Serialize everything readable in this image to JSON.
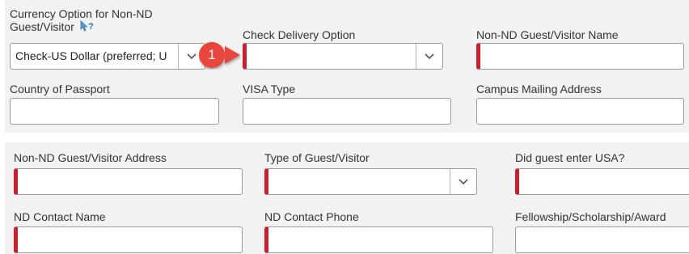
{
  "top": {
    "currency": {
      "label_line1": "Currency Option for Non-ND",
      "label_line2": "Guest/Visitor",
      "value": "Check-US Dollar (preferred; U"
    },
    "check_delivery": {
      "label": "Check Delivery Option",
      "value": ""
    },
    "guest_name": {
      "label": "Non-ND Guest/Visitor Name",
      "value": ""
    },
    "country_passport": {
      "label": "Country of Passport",
      "value": ""
    },
    "visa_type": {
      "label": "VISA Type",
      "value": ""
    },
    "campus_mailing": {
      "label": "Campus Mailing Address",
      "value": ""
    }
  },
  "bottom": {
    "guest_address": {
      "label": "Non-ND Guest/Visitor Address",
      "value": ""
    },
    "guest_type": {
      "label": "Type of Guest/Visitor",
      "value": ""
    },
    "entered_usa": {
      "label": "Did guest enter USA?",
      "value": ""
    },
    "contact_name": {
      "label": "ND Contact Name",
      "value": ""
    },
    "contact_phone": {
      "label": "ND Contact Phone",
      "value": ""
    },
    "fellowship": {
      "label": "Fellowship/Scholarship/Award",
      "value": ""
    }
  },
  "callout": {
    "number": "1"
  },
  "icons": {
    "help": "help-cursor-icon",
    "dropdown": "chevron-down-icon"
  },
  "colors": {
    "required_marker": "#c8202f",
    "callout_badge": "#e8453c",
    "section_background": "#f2f2f2"
  }
}
